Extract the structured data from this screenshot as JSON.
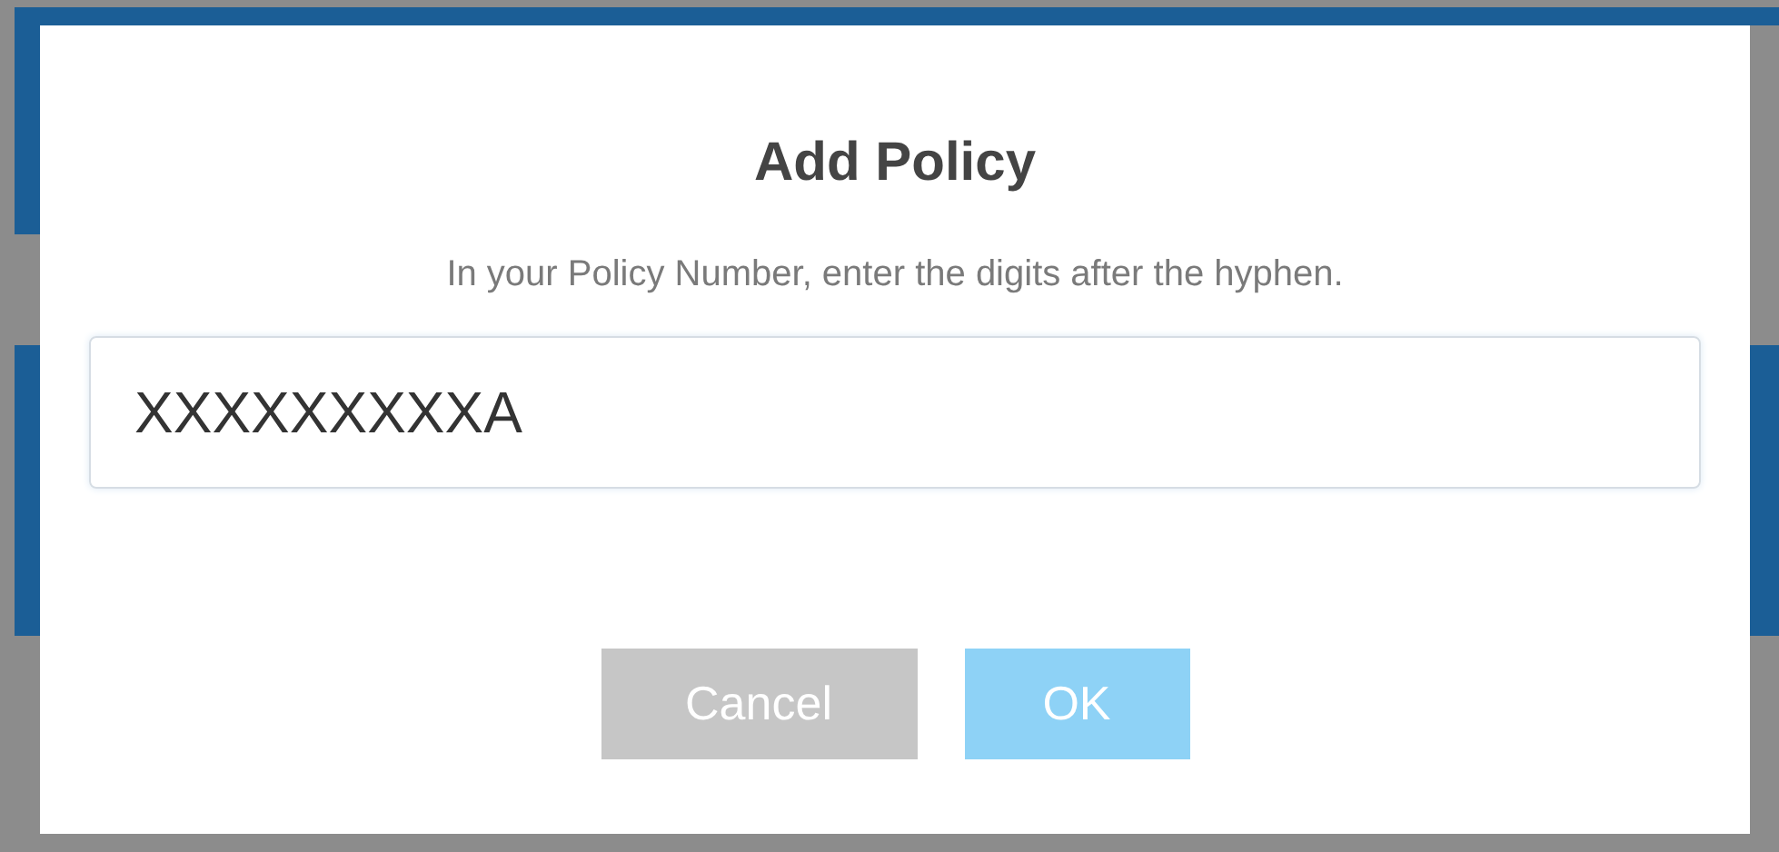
{
  "dialog": {
    "title": "Add Policy",
    "message": "In your Policy Number, enter the digits after the hyphen.",
    "input": {
      "value": "XXXXXXXXXA"
    },
    "buttons": [
      {
        "label": "Cancel",
        "kind": "secondary"
      },
      {
        "label": "OK",
        "kind": "primary"
      }
    ]
  }
}
